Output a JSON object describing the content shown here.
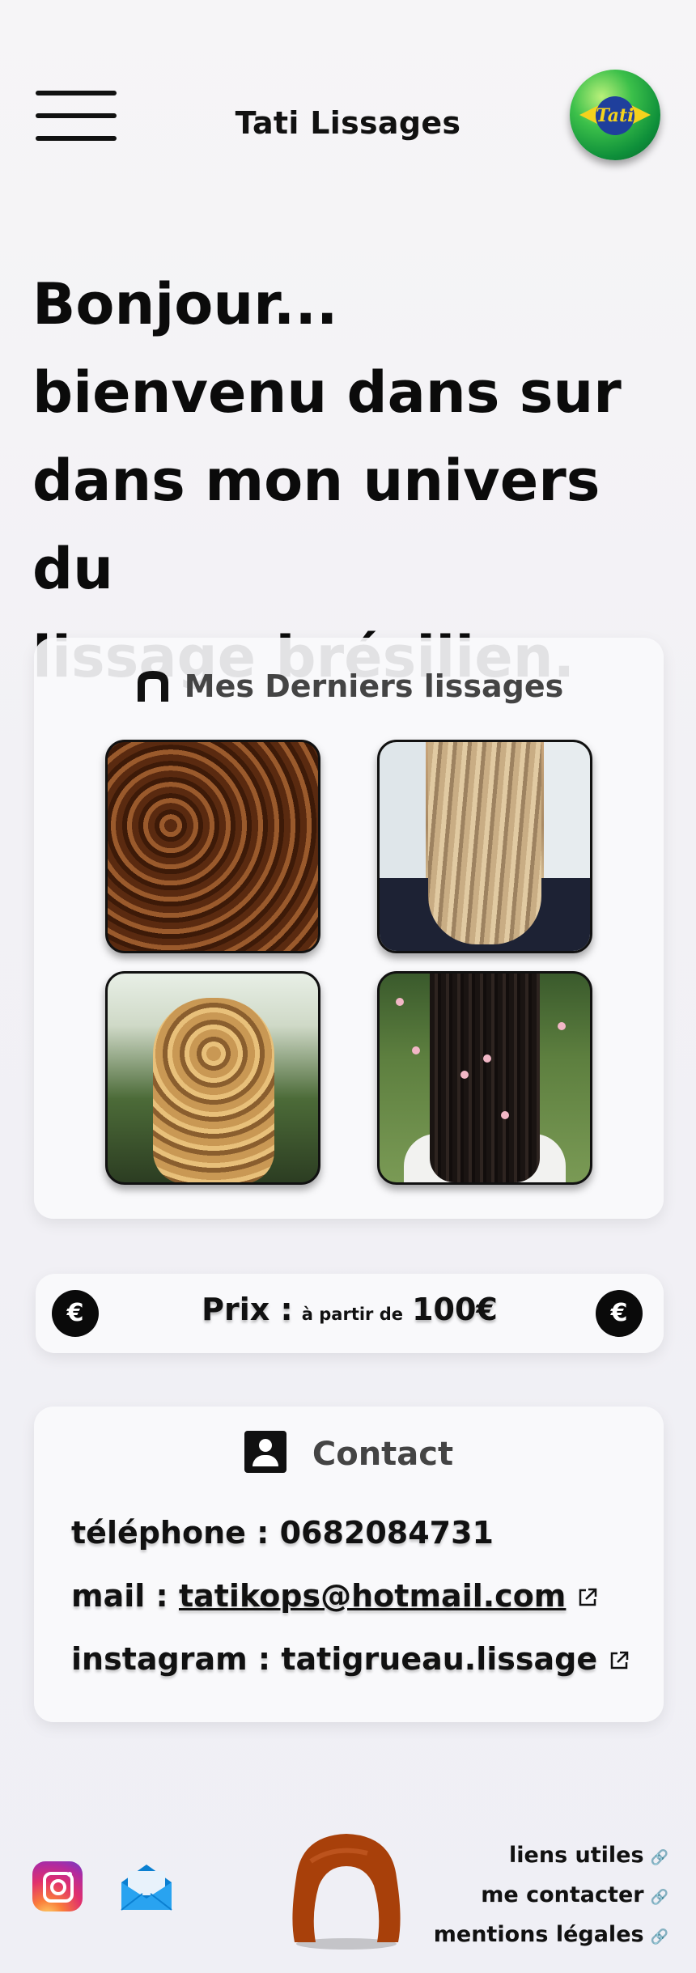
{
  "header": {
    "title": "Tati Lissages",
    "logo_text": "Tati",
    "menu_icon": "hamburger-menu-icon"
  },
  "hero": {
    "lines": [
      "Bonjour...",
      "bienvenu dans sur",
      "dans mon univers du",
      "lissage brésilien."
    ]
  },
  "gallery": {
    "title": "Mes Derniers lissages",
    "icon": "hair-icon",
    "photos": [
      "curly-brown-hair",
      "long-blonde-straightened-hair",
      "wavy-blonde-hair-outdoors",
      "long-black-hair-with-flowers"
    ]
  },
  "price": {
    "label": "Prix :",
    "prefix": "à partir de",
    "amount": "100€",
    "badge": "€"
  },
  "contact": {
    "title": "Contact",
    "phone_label": "téléphone : ",
    "phone": "0682084731",
    "mail_label": "mail : ",
    "mail": "tatikops@hotmail.com",
    "instagram_label": "instagram : ",
    "instagram": "tatigrueau.lissage"
  },
  "footer": {
    "links": [
      "liens utiles",
      "me contacter",
      "mentions légales"
    ],
    "social": [
      "instagram-icon",
      "mail-icon"
    ]
  },
  "colors": {
    "footer_hair": "#a8400a",
    "logo_green": "#2fb54a",
    "logo_yellow": "#f4d21d"
  }
}
